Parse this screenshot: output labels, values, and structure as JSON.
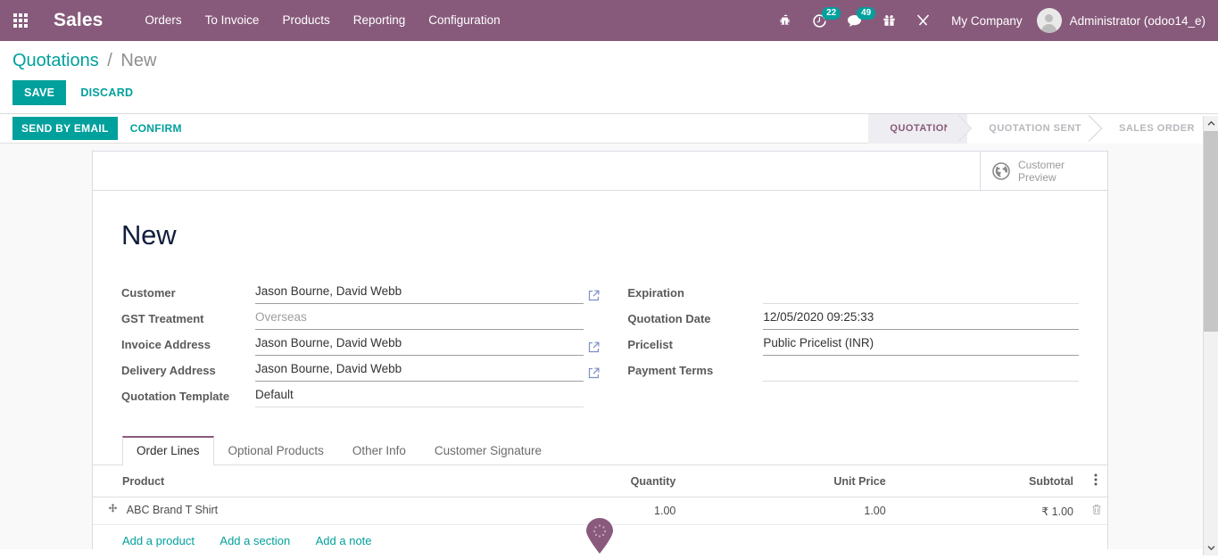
{
  "navbar": {
    "apps_icon": "apps-grid-icon",
    "brand": "Sales",
    "menu": [
      {
        "label": "Orders"
      },
      {
        "label": "To Invoice"
      },
      {
        "label": "Products"
      },
      {
        "label": "Reporting"
      },
      {
        "label": "Configuration"
      }
    ],
    "icons": [
      {
        "name": "bug-icon",
        "badge": null
      },
      {
        "name": "activity-clock-icon",
        "badge": "22"
      },
      {
        "name": "messages-icon",
        "badge": "49"
      },
      {
        "name": "gift-icon",
        "badge": null
      },
      {
        "name": "tools-icon",
        "badge": null
      }
    ],
    "company": "My Company",
    "user": "Administrator (odoo14_e)",
    "bg_color": "#875A7B"
  },
  "control_panel": {
    "breadcrumb_root": "Quotations",
    "breadcrumb_sep": "/",
    "breadcrumb_current": "New",
    "save_label": "SAVE",
    "discard_label": "DISCARD",
    "accent_color": "#00A09D"
  },
  "statusbar": {
    "send_by_email_label": "SEND BY EMAIL",
    "confirm_label": "CONFIRM",
    "steps": [
      {
        "label": "QUOTATION",
        "active": true
      },
      {
        "label": "QUOTATION SENT",
        "active": false
      },
      {
        "label": "SALES ORDER",
        "active": false
      }
    ],
    "active_color": "#875A7B"
  },
  "sheet": {
    "customer_preview_line1": "Customer",
    "customer_preview_line2": "Preview",
    "customer_preview_icon": "globe-icon",
    "record_title": "New",
    "fields_left": [
      {
        "label": "Customer",
        "value": "Jason Bourne, David Webb",
        "muted": false,
        "light": false,
        "ext": true
      },
      {
        "label": "GST Treatment",
        "value": "Overseas",
        "muted": true,
        "light": false,
        "ext": false
      },
      {
        "label": "Invoice Address",
        "value": "Jason Bourne, David Webb",
        "muted": false,
        "light": false,
        "ext": true
      },
      {
        "label": "Delivery Address",
        "value": "Jason Bourne, David Webb",
        "muted": false,
        "light": false,
        "ext": true
      },
      {
        "label": "Quotation Template",
        "value": "Default",
        "muted": false,
        "light": true,
        "ext": false
      }
    ],
    "fields_right": [
      {
        "label": "Expiration",
        "value": "",
        "muted": false,
        "light": true,
        "ext": false
      },
      {
        "label": "Quotation Date",
        "value": "12/05/2020 09:25:33",
        "muted": false,
        "light": false,
        "ext": false
      },
      {
        "label": "Pricelist",
        "value": "Public Pricelist (INR)",
        "muted": false,
        "light": false,
        "ext": false
      },
      {
        "label": "Payment Terms",
        "value": "",
        "muted": false,
        "light": true,
        "ext": false
      }
    ],
    "tabs": [
      {
        "label": "Order Lines",
        "active": true
      },
      {
        "label": "Optional Products",
        "active": false
      },
      {
        "label": "Other Info",
        "active": false
      },
      {
        "label": "Customer Signature",
        "active": false
      }
    ],
    "table": {
      "headers": [
        "Product",
        "Quantity",
        "Unit Price",
        "Subtotal"
      ],
      "options_icon": "column-options-icon",
      "rows": [
        {
          "drag_icon": "drag-handle-icon",
          "product": "ABC Brand T Shirt",
          "quantity": "1.00",
          "unit_price": "1.00",
          "subtotal": "₹ 1.00",
          "delete_icon": "trash-icon"
        }
      ],
      "add_links": [
        {
          "label": "Add a product"
        },
        {
          "label": "Add a section"
        },
        {
          "label": "Add a note"
        }
      ]
    }
  },
  "overlay": {
    "pin_marker": "map-pin-loading-marker",
    "pin_color": "#8a5a7d"
  },
  "scrollbar": {
    "up_arrow": "scroll-up-arrow",
    "down_arrow": "scroll-down-arrow",
    "thumb": "scroll-thumb"
  }
}
